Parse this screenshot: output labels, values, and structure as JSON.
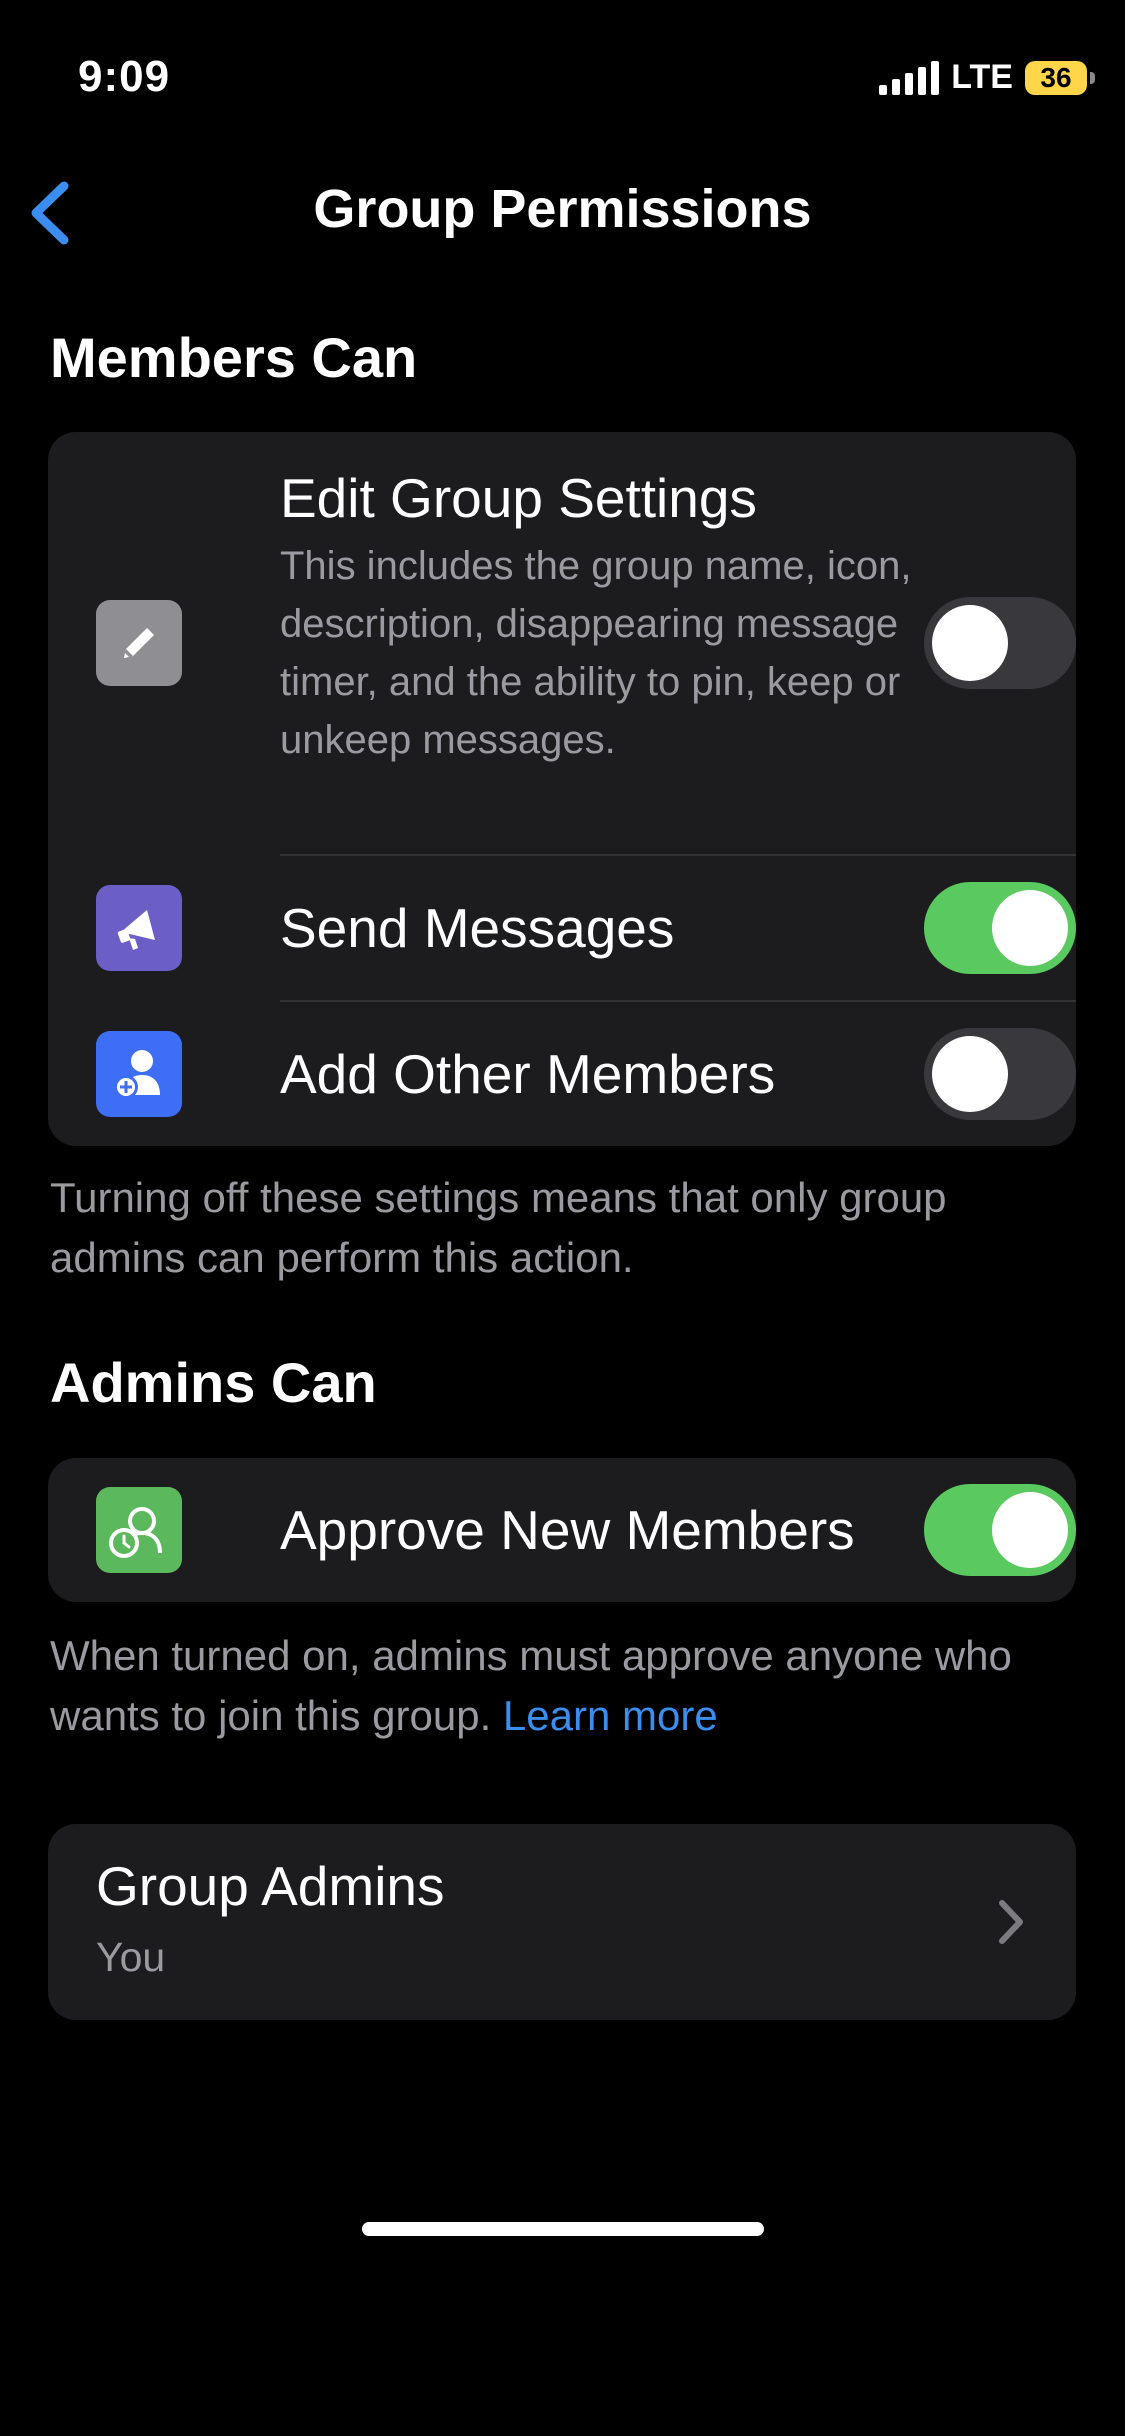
{
  "status": {
    "time": "9:09",
    "network": "LTE",
    "battery": "36"
  },
  "nav": {
    "title": "Group Permissions"
  },
  "members_section": {
    "title": "Members Can",
    "items": [
      {
        "label": "Edit Group Settings",
        "description": "This includes the group name, icon, description, disappearing message timer, and the ability to pin, keep or unkeep messages.",
        "icon": "pencil-icon",
        "enabled": false
      },
      {
        "label": "Send Messages",
        "icon": "megaphone-icon",
        "enabled": true
      },
      {
        "label": "Add Other Members",
        "icon": "add-member-icon",
        "enabled": false
      }
    ],
    "footnote": "Turning off these settings means that only group admins can perform this action."
  },
  "admins_section": {
    "title": "Admins Can",
    "items": [
      {
        "label": "Approve New Members",
        "icon": "approve-members-icon",
        "enabled": true
      }
    ],
    "footnote": "When turned on, admins must approve anyone who wants to join this group.",
    "link": "Learn more"
  },
  "group_admins": {
    "title": "Group Admins",
    "value": "You"
  },
  "colors": {
    "background": "#000000",
    "card": "#1c1c1e",
    "toggle_on": "#5ac95f",
    "link": "#3b8ef0"
  }
}
